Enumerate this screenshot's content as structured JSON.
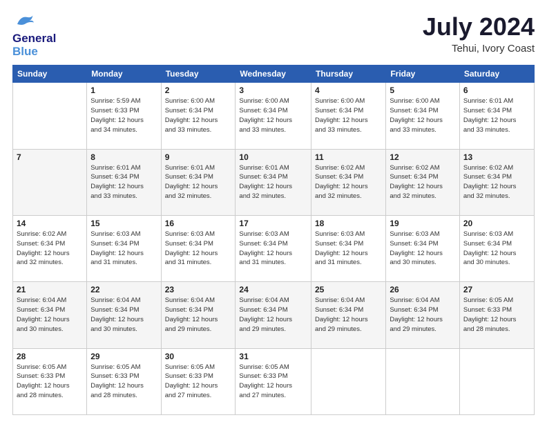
{
  "header": {
    "logo_line1": "General",
    "logo_line2": "Blue",
    "month": "July 2024",
    "location": "Tehui, Ivory Coast"
  },
  "days_of_week": [
    "Sunday",
    "Monday",
    "Tuesday",
    "Wednesday",
    "Thursday",
    "Friday",
    "Saturday"
  ],
  "weeks": [
    [
      {
        "day": "",
        "info": ""
      },
      {
        "day": "1",
        "info": "Sunrise: 5:59 AM\nSunset: 6:33 PM\nDaylight: 12 hours\nand 34 minutes."
      },
      {
        "day": "2",
        "info": "Sunrise: 6:00 AM\nSunset: 6:34 PM\nDaylight: 12 hours\nand 33 minutes."
      },
      {
        "day": "3",
        "info": "Sunrise: 6:00 AM\nSunset: 6:34 PM\nDaylight: 12 hours\nand 33 minutes."
      },
      {
        "day": "4",
        "info": "Sunrise: 6:00 AM\nSunset: 6:34 PM\nDaylight: 12 hours\nand 33 minutes."
      },
      {
        "day": "5",
        "info": "Sunrise: 6:00 AM\nSunset: 6:34 PM\nDaylight: 12 hours\nand 33 minutes."
      },
      {
        "day": "6",
        "info": "Sunrise: 6:01 AM\nSunset: 6:34 PM\nDaylight: 12 hours\nand 33 minutes."
      }
    ],
    [
      {
        "day": "7",
        "info": ""
      },
      {
        "day": "8",
        "info": "Sunrise: 6:01 AM\nSunset: 6:34 PM\nDaylight: 12 hours\nand 33 minutes."
      },
      {
        "day": "9",
        "info": "Sunrise: 6:01 AM\nSunset: 6:34 PM\nDaylight: 12 hours\nand 32 minutes."
      },
      {
        "day": "10",
        "info": "Sunrise: 6:01 AM\nSunset: 6:34 PM\nDaylight: 12 hours\nand 32 minutes."
      },
      {
        "day": "11",
        "info": "Sunrise: 6:02 AM\nSunset: 6:34 PM\nDaylight: 12 hours\nand 32 minutes."
      },
      {
        "day": "12",
        "info": "Sunrise: 6:02 AM\nSunset: 6:34 PM\nDaylight: 12 hours\nand 32 minutes."
      },
      {
        "day": "13",
        "info": "Sunrise: 6:02 AM\nSunset: 6:34 PM\nDaylight: 12 hours\nand 32 minutes."
      }
    ],
    [
      {
        "day": "14",
        "info": "Sunrise: 6:02 AM\nSunset: 6:34 PM\nDaylight: 12 hours\nand 32 minutes."
      },
      {
        "day": "15",
        "info": "Sunrise: 6:03 AM\nSunset: 6:34 PM\nDaylight: 12 hours\nand 31 minutes."
      },
      {
        "day": "16",
        "info": "Sunrise: 6:03 AM\nSunset: 6:34 PM\nDaylight: 12 hours\nand 31 minutes."
      },
      {
        "day": "17",
        "info": "Sunrise: 6:03 AM\nSunset: 6:34 PM\nDaylight: 12 hours\nand 31 minutes."
      },
      {
        "day": "18",
        "info": "Sunrise: 6:03 AM\nSunset: 6:34 PM\nDaylight: 12 hours\nand 31 minutes."
      },
      {
        "day": "19",
        "info": "Sunrise: 6:03 AM\nSunset: 6:34 PM\nDaylight: 12 hours\nand 30 minutes."
      },
      {
        "day": "20",
        "info": "Sunrise: 6:03 AM\nSunset: 6:34 PM\nDaylight: 12 hours\nand 30 minutes."
      }
    ],
    [
      {
        "day": "21",
        "info": "Sunrise: 6:04 AM\nSunset: 6:34 PM\nDaylight: 12 hours\nand 30 minutes."
      },
      {
        "day": "22",
        "info": "Sunrise: 6:04 AM\nSunset: 6:34 PM\nDaylight: 12 hours\nand 30 minutes."
      },
      {
        "day": "23",
        "info": "Sunrise: 6:04 AM\nSunset: 6:34 PM\nDaylight: 12 hours\nand 29 minutes."
      },
      {
        "day": "24",
        "info": "Sunrise: 6:04 AM\nSunset: 6:34 PM\nDaylight: 12 hours\nand 29 minutes."
      },
      {
        "day": "25",
        "info": "Sunrise: 6:04 AM\nSunset: 6:34 PM\nDaylight: 12 hours\nand 29 minutes."
      },
      {
        "day": "26",
        "info": "Sunrise: 6:04 AM\nSunset: 6:34 PM\nDaylight: 12 hours\nand 29 minutes."
      },
      {
        "day": "27",
        "info": "Sunrise: 6:05 AM\nSunset: 6:33 PM\nDaylight: 12 hours\nand 28 minutes."
      }
    ],
    [
      {
        "day": "28",
        "info": "Sunrise: 6:05 AM\nSunset: 6:33 PM\nDaylight: 12 hours\nand 28 minutes."
      },
      {
        "day": "29",
        "info": "Sunrise: 6:05 AM\nSunset: 6:33 PM\nDaylight: 12 hours\nand 28 minutes."
      },
      {
        "day": "30",
        "info": "Sunrise: 6:05 AM\nSunset: 6:33 PM\nDaylight: 12 hours\nand 27 minutes."
      },
      {
        "day": "31",
        "info": "Sunrise: 6:05 AM\nSunset: 6:33 PM\nDaylight: 12 hours\nand 27 minutes."
      },
      {
        "day": "",
        "info": ""
      },
      {
        "day": "",
        "info": ""
      },
      {
        "day": "",
        "info": ""
      }
    ]
  ]
}
